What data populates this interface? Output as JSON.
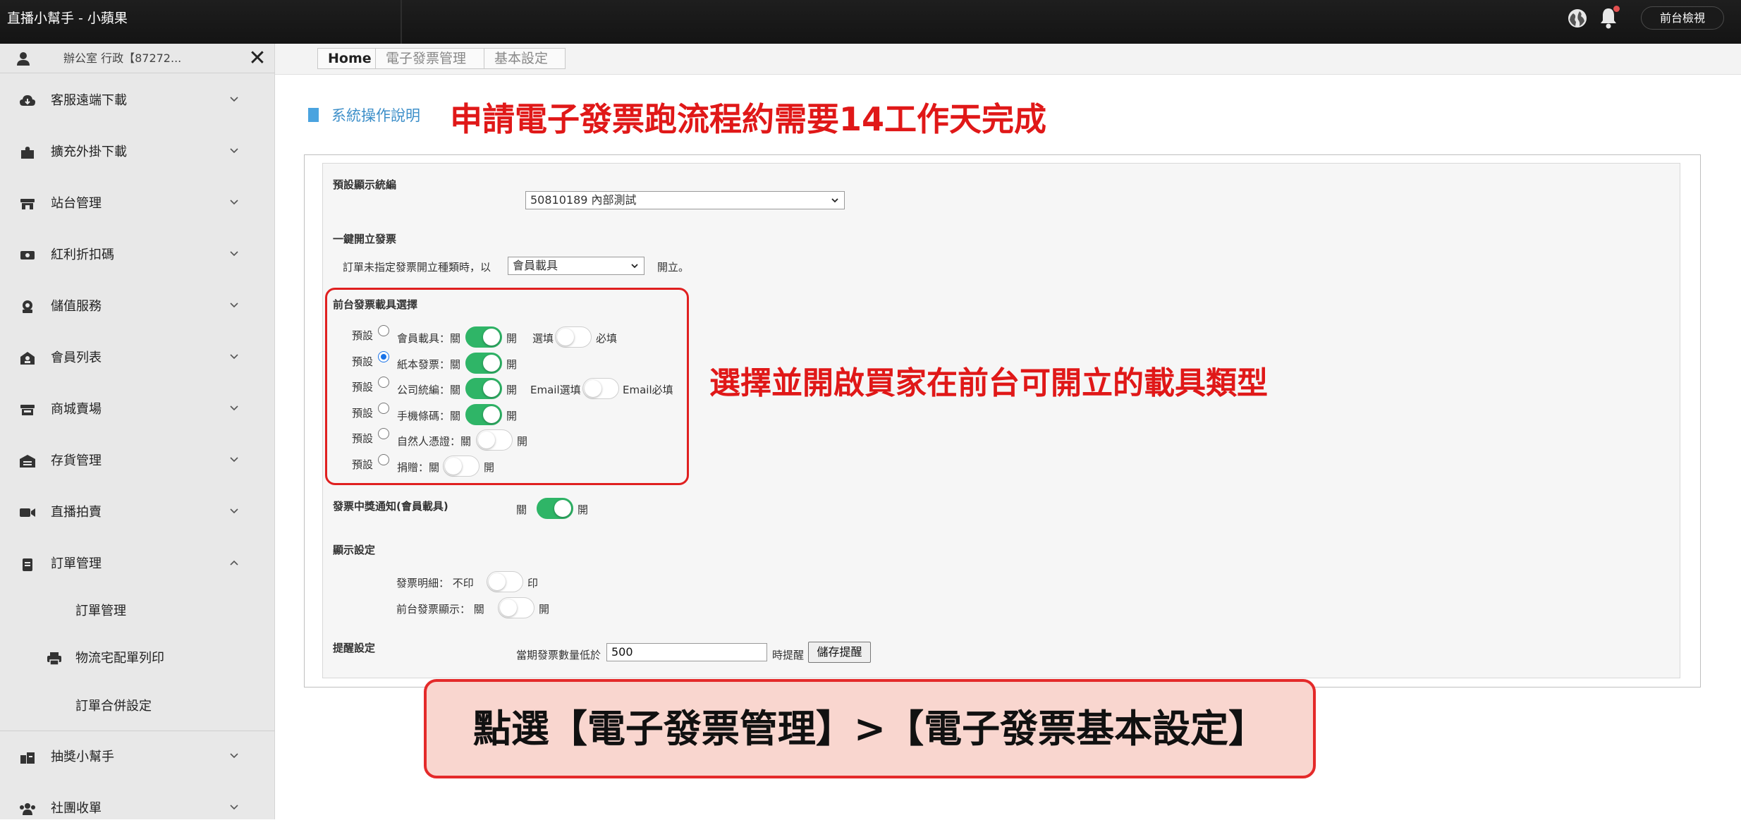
{
  "app": {
    "title": "直播小幫手 - 小蘋果",
    "front_button": "前台檢視"
  },
  "sidebar": {
    "user": "辦公室 行政【87272...",
    "items": [
      {
        "label": "客服遠端下載",
        "icon": "cloud-download-icon"
      },
      {
        "label": "擴充外掛下載",
        "icon": "puzzle-icon"
      },
      {
        "label": "站台管理",
        "icon": "store-icon"
      },
      {
        "label": "紅利折扣碼",
        "icon": "ticket-icon"
      },
      {
        "label": "儲值服務",
        "icon": "wallet-icon"
      },
      {
        "label": "會員列表",
        "icon": "member-icon"
      },
      {
        "label": "商城賣場",
        "icon": "shop-icon"
      },
      {
        "label": "存貨管理",
        "icon": "warehouse-icon"
      },
      {
        "label": "直播拍賣",
        "icon": "video-icon"
      },
      {
        "label": "訂單管理",
        "icon": "clipboard-icon"
      },
      {
        "label": "抽獎小幫手",
        "icon": "gift-icon"
      },
      {
        "label": "社團收單",
        "icon": "group-icon"
      }
    ],
    "subitems": [
      "訂單管理",
      "物流宅配單列印",
      "訂單合併設定"
    ]
  },
  "breadcrumb": [
    "Home",
    "電子發票管理",
    "基本設定"
  ],
  "heading": {
    "help": "系統操作說明",
    "notice": "申請電子發票跑流程約需要14工作天完成"
  },
  "form": {
    "default_display": {
      "label": "預設顯示統編",
      "value": "50810189 內部測試"
    },
    "one_click": {
      "label": "一鍵開立發票",
      "prefix": "訂單未指定發票開立種類時，以",
      "value": "會員載具",
      "suffix": "開立。"
    },
    "carrier_section": "前台發票載具選擇",
    "default_label": "預設",
    "carriers": [
      {
        "label": "會員載具：關",
        "on": "開",
        "enabled": true,
        "default": false,
        "extra": {
          "left": "選填",
          "right": "必填",
          "enabled": false
        }
      },
      {
        "label": "紙本發票：關",
        "on": "開",
        "enabled": true,
        "default": true
      },
      {
        "label": "公司統編：關",
        "on": "開",
        "enabled": true,
        "default": false,
        "extra": {
          "left": "Email選填",
          "right": "Email必填",
          "enabled": false
        }
      },
      {
        "label": "手機條碼：關",
        "on": "開",
        "enabled": true,
        "default": false
      },
      {
        "label": "自然人憑證：關",
        "on": "開",
        "enabled": false,
        "default": false
      },
      {
        "label": "捐贈：關",
        "on": "開",
        "enabled": false,
        "default": false
      }
    ],
    "winning": {
      "label": "發票中獎通知(會員載具)",
      "off": "關",
      "on": "開",
      "enabled": true
    },
    "display": {
      "label": "顯示設定",
      "detail": {
        "label": "發票明細： 不印",
        "on": "印",
        "enabled": false
      },
      "front": {
        "label": "前台發票顯示： 關",
        "on": "開",
        "enabled": false
      }
    },
    "reminder": {
      "label": "提醒設定",
      "prefix": "當期發票數量低於",
      "value": "500",
      "suffix": "時提醒",
      "button": "儲存提醒"
    }
  },
  "annotations": {
    "carrier_note": "選擇並開啟買家在前台可開立的載具類型",
    "callout": "點選【電子發票管理】>【電子發票基本設定】"
  },
  "colors": {
    "toggle_on": "#2fb567",
    "annotation_red": "#e01818",
    "callout_bg": "#f9d6cf",
    "accent_blue": "#3d8fc9"
  }
}
